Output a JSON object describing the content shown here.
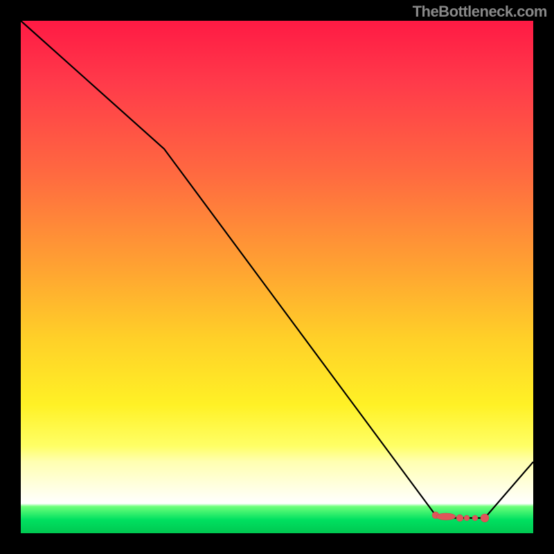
{
  "attribution": "TheBottleneck.com",
  "chart_data": {
    "type": "line",
    "title": "",
    "xlabel": "",
    "ylabel": "",
    "xlim": [
      0,
      100
    ],
    "ylim": [
      0,
      100
    ],
    "series": [
      {
        "name": "bottleneck-curve",
        "x": [
          0,
          28,
          81,
          84,
          90.5,
          100
        ],
        "values": [
          100,
          75,
          3.5,
          3,
          3,
          14
        ]
      }
    ],
    "markers": {
      "name": "optimum-range",
      "x": [
        81,
        82.5,
        84,
        85.5,
        87,
        88,
        90.5
      ],
      "values": [
        3.5,
        3.3,
        3,
        3,
        3,
        3,
        3
      ]
    },
    "background": "red-yellow-green-gradient"
  }
}
